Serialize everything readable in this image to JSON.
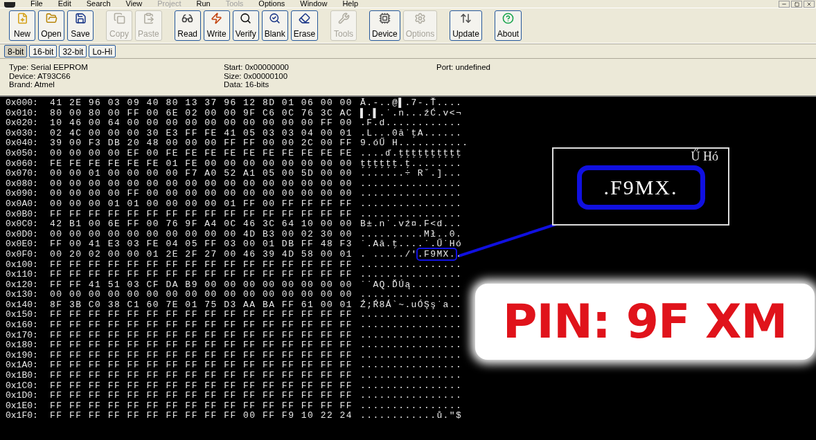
{
  "menu": [
    {
      "label": "File",
      "disabled": false
    },
    {
      "label": "Edit",
      "disabled": false
    },
    {
      "label": "Search",
      "disabled": false
    },
    {
      "label": "View",
      "disabled": false
    },
    {
      "label": "Project",
      "disabled": true
    },
    {
      "label": "Run",
      "disabled": false
    },
    {
      "label": "Tools",
      "disabled": true
    },
    {
      "label": "Options",
      "disabled": false
    },
    {
      "label": "Window",
      "disabled": false
    },
    {
      "label": "Help",
      "disabled": false
    }
  ],
  "toolbar": [
    [
      {
        "label": "New",
        "disabled": false
      },
      {
        "label": "Open",
        "disabled": false
      },
      {
        "label": "Save",
        "disabled": false
      }
    ],
    [
      {
        "label": "Copy",
        "disabled": true
      },
      {
        "label": "Paste",
        "disabled": true
      }
    ],
    [
      {
        "label": "Read",
        "disabled": false
      },
      {
        "label": "Write",
        "disabled": false
      },
      {
        "label": "Verify",
        "disabled": false
      },
      {
        "label": "Blank",
        "disabled": false
      },
      {
        "label": "Erase",
        "disabled": false
      }
    ],
    [
      {
        "label": "Tools",
        "disabled": true
      }
    ],
    [
      {
        "label": "Device",
        "disabled": false
      },
      {
        "label": "Options",
        "disabled": true
      }
    ],
    [
      {
        "label": "Update",
        "disabled": false
      }
    ],
    [
      {
        "label": "About",
        "disabled": false
      }
    ]
  ],
  "view_modes": [
    {
      "label": "8-bit",
      "selected": true
    },
    {
      "label": "16-bit",
      "selected": false
    },
    {
      "label": "32-bit",
      "selected": false
    },
    {
      "label": "Lo-Hi",
      "selected": false
    }
  ],
  "info": [
    [
      "Type: Serial EEPROM",
      "Device: AT93C66",
      "Brand: Atmel"
    ],
    [
      "Start: 0x00000000",
      "Size: 0x00000100",
      "Data: 16-bits"
    ],
    [
      "Port: undefined"
    ]
  ],
  "hex_rows": [
    {
      "address": "0x000:",
      "bytes": "41 2E 96 03 09 40 80 13 37 96 12 8D 01 06 00 00",
      "ascii": "Ā.-..@▌.7-.Ť...."
    },
    {
      "address": "0x010:",
      "bytes": "80 00 80 00 FF 00 6E 02 00 00 9F C6 0C 76 3C AC",
      "ascii": "▌.▌.˙.n...źĆ.v<¬"
    },
    {
      "address": "0x020:",
      "bytes": "10 46 00 64 00 00 00 00 00 00 00 00 00 00 FF 00",
      "ascii": ".F.d............"
    },
    {
      "address": "0x030:",
      "bytes": "02 4C 00 00 00 30 E3 FF FE 41 05 03 03 04 00 01",
      "ascii": ".L...0ă˙ţA......"
    },
    {
      "address": "0x040:",
      "bytes": "39 00 F3 DB 20 48 00 00 00 FF FF 00 00 2C 00 FF",
      "ascii": "9.óŰ H..........."
    },
    {
      "address": "0x050:",
      "bytes": "00 00 00 00 EF 00 FE FE FE FE FE FE FE FE FE FE",
      "ascii": "....ď.ţţţţţţţţţţ"
    },
    {
      "address": "0x060:",
      "bytes": "FE FE FE FE FE FE 01 FE 00 00 00 00 00 00 00 00",
      "ascii": "ţţţţţţ.ţ........"
    },
    {
      "address": "0x070:",
      "bytes": "00 00 01 00 00 00 00 F7 A0 52 A1 05 00 5D 00 00",
      "ascii": ".......÷ R˘.]..."
    },
    {
      "address": "0x080:",
      "bytes": "00 00 00 00 00 00 00 00 00 00 00 00 00 00 00 00",
      "ascii": "................"
    },
    {
      "address": "0x090:",
      "bytes": "00 00 00 00 FF 00 00 00 00 00 00 00 00 00 00 00",
      "ascii": "................"
    },
    {
      "address": "0x0A0:",
      "bytes": "00 00 00 01 01 00 00 00 00 01 FF 00 FF FF FF FF",
      "ascii": "................"
    },
    {
      "address": "0x0B0:",
      "bytes": "FF FF FF FF FF FF FF FF FF FF FF FF FF FF FF FF",
      "ascii": "................"
    },
    {
      "address": "0x0C0:",
      "bytes": "42 B1 00 6E FF 00 76 9F A4 0C 46 3C 64 10 00 00",
      "ascii": "B±.n˙.vź¤.F<d..."
    },
    {
      "address": "0x0D0:",
      "bytes": "00 00 00 00 00 00 00 00 00 00 4D B3 00 02 30 00",
      "ascii": "..........Mł..0."
    },
    {
      "address": "0x0E0:",
      "bytes": "FF 00 41 E3 03 FE 04 05 FF 03 00 01 DB FF 48 F3",
      "ascii": "˙.Aă.ţ....˙.Ű˙Hó"
    },
    {
      "address": "0x0F0:",
      "bytes": "00 20 02 00 00 01 2E 2F 27 00 46 39 4D 58 00 01",
      "ascii": ". ...../'.F9MX..",
      "highlighted": true
    },
    {
      "address": "0x100:",
      "bytes": "FF FF FF FF FF FF FF FF FF FF FF FF FF FF FF FF",
      "ascii": "................"
    },
    {
      "address": "0x110:",
      "bytes": "FF FF FF FF FF FF FF FF FF FF FF FF FF FF FF FF",
      "ascii": "................"
    },
    {
      "address": "0x120:",
      "bytes": "FF FF 41 51 03 CF DA B9 00 00 00 00 00 00 00 00",
      "ascii": "˙˙AQ.ĎÚą........"
    },
    {
      "address": "0x130:",
      "bytes": "00 00 00 00 00 00 00 00 00 00 00 00 00 00 00 00",
      "ascii": "................"
    },
    {
      "address": "0x140:",
      "bytes": "8F 3B C0 38 C1 60 7E 01 75 D3 AA BA FF 61 00 01",
      "ascii": "Ź;Ŕ8Á`~.uÓŞş˙a.."
    },
    {
      "address": "0x150:",
      "bytes": "FF FF FF FF FF FF FF FF FF FF FF FF FF FF FF FF",
      "ascii": "................"
    },
    {
      "address": "0x160:",
      "bytes": "FF FF FF FF FF FF FF FF FF FF FF FF FF FF FF FF",
      "ascii": "................"
    },
    {
      "address": "0x170:",
      "bytes": "FF FF FF FF FF FF FF FF FF FF FF FF FF FF FF FF",
      "ascii": "................"
    },
    {
      "address": "0x180:",
      "bytes": "FF FF FF FF FF FF FF FF FF FF FF FF FF FF FF FF",
      "ascii": "................"
    },
    {
      "address": "0x190:",
      "bytes": "FF FF FF FF FF FF FF FF FF FF FF FF FF FF FF FF",
      "ascii": "................"
    },
    {
      "address": "0x1A0:",
      "bytes": "FF FF FF FF FF FF FF FF FF FF FF FF FF FF FF FF",
      "ascii": "................"
    },
    {
      "address": "0x1B0:",
      "bytes": "FF FF FF FF FF FF FF FF FF FF FF FF FF FF FF FF",
      "ascii": "................"
    },
    {
      "address": "0x1C0:",
      "bytes": "FF FF FF FF FF FF FF FF FF FF FF FF FF FF FF FF",
      "ascii": "................"
    },
    {
      "address": "0x1D0:",
      "bytes": "FF FF FF FF FF FF FF FF FF FF FF FF FF FF FF FF",
      "ascii": "................"
    },
    {
      "address": "0x1E0:",
      "bytes": "FF FF FF FF FF FF FF FF FF FF FF FF FF FF FF FF",
      "ascii": "................"
    },
    {
      "address": "0x1F0:",
      "bytes": "FF FF FF FF FF FF FF FF FF FF 00 FF F9 10 22 24",
      "ascii": "............ů.\"$"
    }
  ],
  "callout": {
    "magnified_above": "Ű Hó",
    "magnified_text": ".F9MX.",
    "pin_label": "PIN: 9F XM"
  }
}
